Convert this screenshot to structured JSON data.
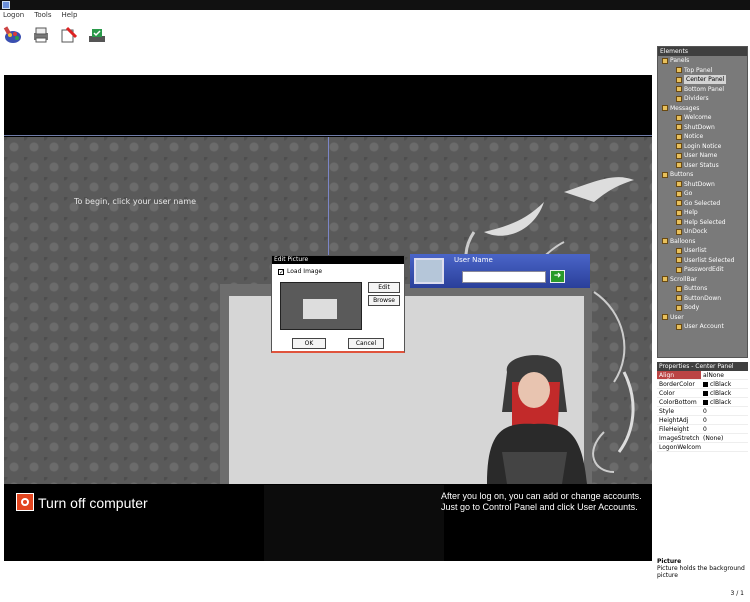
{
  "menu": [
    "Logon",
    "Tools",
    "Help"
  ],
  "toolbar": [
    "open-icon",
    "print-icon",
    "erase-icon",
    "apply-icon"
  ],
  "welcome_text": "To begin, click your user name",
  "dialog": {
    "title": "Edit Picture",
    "checkbox_label": "Load Image",
    "checked": true,
    "edit_label": "Edit",
    "browse_label": "Browse",
    "ok_label": "OK",
    "cancel_label": "Cancel"
  },
  "user_tile": {
    "name": "User Name",
    "password_value": "",
    "go_icon": "arrow-right-icon"
  },
  "bottom": {
    "turnoff_label": "Turn off computer",
    "hint_line1": "After you log on, you can add or change accounts.",
    "hint_line2": "Just go to Control Panel and click User Accounts."
  },
  "tree": {
    "title": "Elements",
    "nodes": [
      {
        "label": "Panels",
        "level": 0
      },
      {
        "label": "Top Panel",
        "level": 1
      },
      {
        "label": "Center Panel",
        "level": 1,
        "selected": true
      },
      {
        "label": "Bottom Panel",
        "level": 1
      },
      {
        "label": "Dividers",
        "level": 1
      },
      {
        "label": "Messages",
        "level": 0
      },
      {
        "label": "Welcome",
        "level": 1
      },
      {
        "label": "ShutDown",
        "level": 1
      },
      {
        "label": "Notice",
        "level": 1
      },
      {
        "label": "Login Notice",
        "level": 1
      },
      {
        "label": "User Name",
        "level": 1
      },
      {
        "label": "User Status",
        "level": 1
      },
      {
        "label": "Buttons",
        "level": 0
      },
      {
        "label": "ShutDown",
        "level": 1
      },
      {
        "label": "Go",
        "level": 1
      },
      {
        "label": "Go Selected",
        "level": 1
      },
      {
        "label": "Help",
        "level": 1
      },
      {
        "label": "Help Selected",
        "level": 1
      },
      {
        "label": "UnDock",
        "level": 1
      },
      {
        "label": "Balloons",
        "level": 0
      },
      {
        "label": "Userlist",
        "level": 1
      },
      {
        "label": "Userlist Selected",
        "level": 1
      },
      {
        "label": "PasswordEdit",
        "level": 1
      },
      {
        "label": "ScrollBar",
        "level": 0
      },
      {
        "label": "Buttons",
        "level": 1
      },
      {
        "label": "ButtonDown",
        "level": 1
      },
      {
        "label": "Body",
        "level": 1
      },
      {
        "label": "User",
        "level": 0
      },
      {
        "label": "User Account",
        "level": 1
      }
    ]
  },
  "properties": {
    "title": "Properties - Center Panel",
    "rows": [
      {
        "key": "Align",
        "value": "alNone",
        "active": true
      },
      {
        "key": "BorderColor",
        "value": "clBlack",
        "swatch": true
      },
      {
        "key": "Color",
        "value": "clBlack",
        "swatch": true
      },
      {
        "key": "ColorBottom",
        "value": "clBlack",
        "swatch": true
      },
      {
        "key": "Style",
        "value": "0"
      },
      {
        "key": "HeightAdj",
        "value": "0"
      },
      {
        "key": "FileHeight",
        "value": "0"
      },
      {
        "key": "ImageStretch",
        "value": "(None)"
      },
      {
        "key": "LogonWelcome",
        "value": ""
      }
    ]
  },
  "description": {
    "title": "Picture",
    "text": "Picture holds the background picture"
  },
  "status_number": "3 / 1"
}
